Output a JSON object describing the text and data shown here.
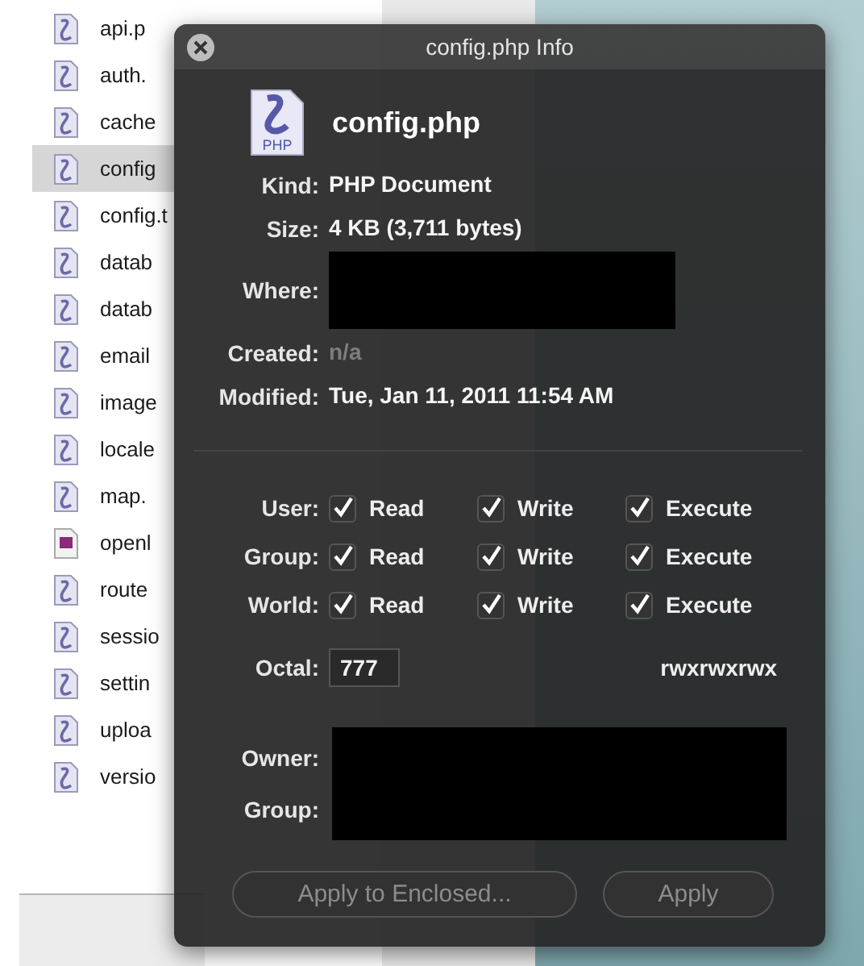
{
  "files": [
    {
      "name": "api.p",
      "kind": "php",
      "selected": false
    },
    {
      "name": "auth.",
      "kind": "php",
      "selected": false
    },
    {
      "name": "cache",
      "kind": "php",
      "selected": false
    },
    {
      "name": "config",
      "kind": "php",
      "selected": true
    },
    {
      "name": "config.t",
      "kind": "php",
      "selected": false
    },
    {
      "name": "datab",
      "kind": "php",
      "selected": false
    },
    {
      "name": "datab",
      "kind": "php",
      "selected": false
    },
    {
      "name": "email",
      "kind": "php",
      "selected": false
    },
    {
      "name": "image",
      "kind": "php",
      "selected": false
    },
    {
      "name": "locale",
      "kind": "php",
      "selected": false
    },
    {
      "name": "map.",
      "kind": "php",
      "selected": false
    },
    {
      "name": "openl",
      "kind": "cfg",
      "selected": false
    },
    {
      "name": "route",
      "kind": "php",
      "selected": false
    },
    {
      "name": "sessio",
      "kind": "php",
      "selected": false
    },
    {
      "name": "settin",
      "kind": "php",
      "selected": false
    },
    {
      "name": "uploa",
      "kind": "php",
      "selected": false
    },
    {
      "name": "versio",
      "kind": "php",
      "selected": false
    }
  ],
  "info": {
    "title": "config.php Info",
    "name": "config.php",
    "icon_label": "PHP",
    "details": [
      {
        "label": "Kind:",
        "kind": "text",
        "value": "PHP Document",
        "dimmed": false
      },
      {
        "label": "Size:",
        "kind": "text",
        "value": "4 KB (3,711 bytes)",
        "dimmed": false
      },
      {
        "label": "Where:",
        "kind": "redacted"
      },
      {
        "label": "Created:",
        "kind": "text",
        "value": "n/a",
        "dimmed": true
      },
      {
        "label": "Modified:",
        "kind": "text",
        "value": "Tue, Jan 11, 2011 11:54 AM",
        "dimmed": false
      }
    ],
    "permissions": [
      {
        "label": "User:",
        "options": [
          {
            "label": "Read",
            "checked": true
          },
          {
            "label": "Write",
            "checked": true
          },
          {
            "label": "Execute",
            "checked": true
          }
        ]
      },
      {
        "label": "Group:",
        "options": [
          {
            "label": "Read",
            "checked": true
          },
          {
            "label": "Write",
            "checked": true
          },
          {
            "label": "Execute",
            "checked": true
          }
        ]
      },
      {
        "label": "World:",
        "options": [
          {
            "label": "Read",
            "checked": true
          },
          {
            "label": "Write",
            "checked": true
          },
          {
            "label": "Execute",
            "checked": true
          }
        ]
      }
    ],
    "octal": {
      "label": "Octal:",
      "value": "777"
    },
    "symbolic": "rwxrwxrwx",
    "ownership": [
      {
        "label": "Owner:"
      },
      {
        "label": "Group:"
      }
    ],
    "buttons": [
      {
        "label": "Apply to Enclosed...",
        "disabled": true
      },
      {
        "label": "Apply",
        "disabled": true
      }
    ]
  }
}
